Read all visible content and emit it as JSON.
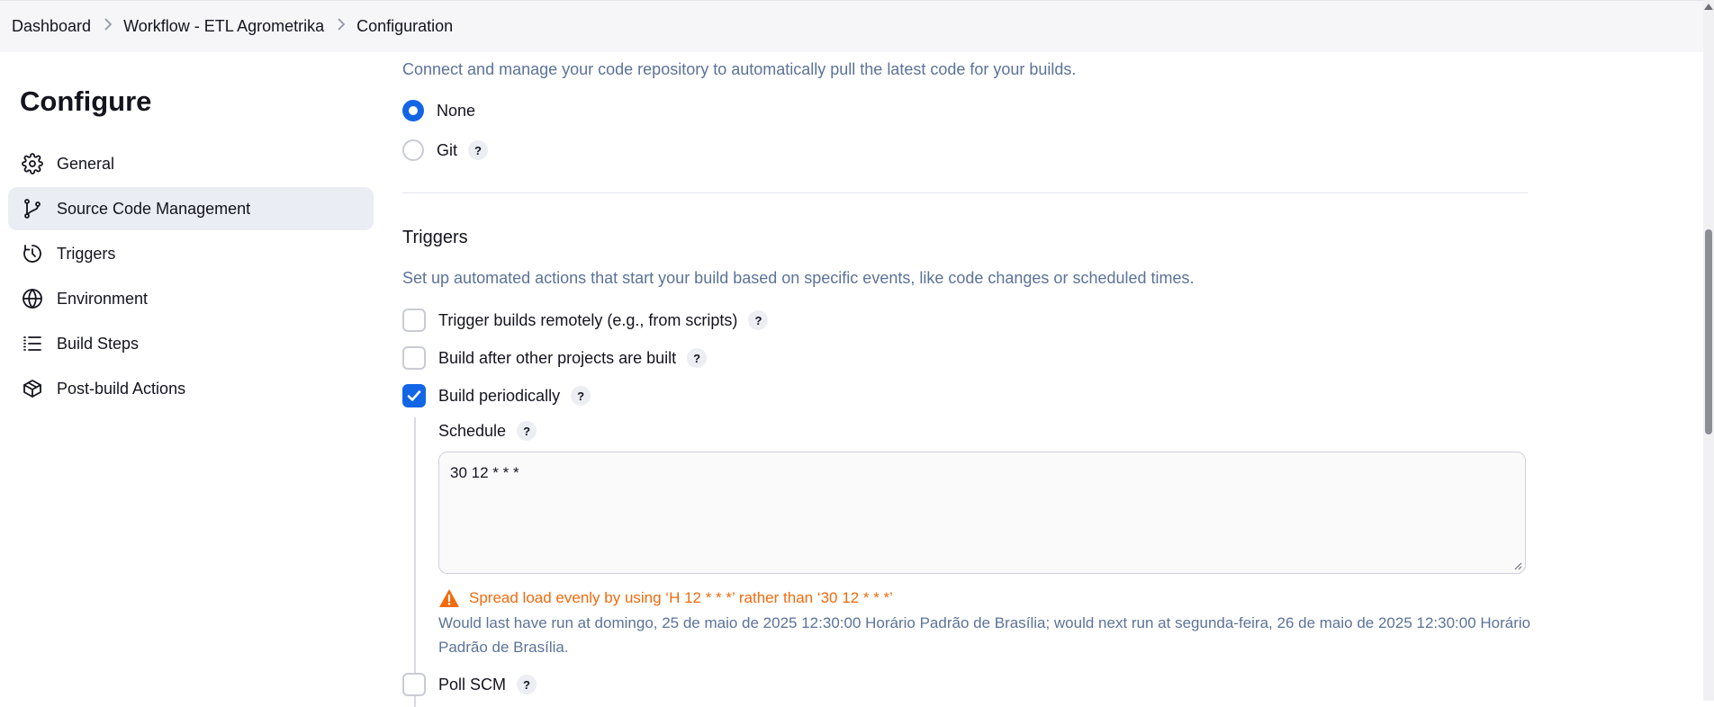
{
  "breadcrumb": {
    "items": [
      "Dashboard",
      "Workflow - ETL Agrometrika",
      "Configuration"
    ],
    "separator_icon": "chevron-right-icon"
  },
  "sidebar": {
    "title": "Configure",
    "items": [
      {
        "label": "General",
        "icon": "gear-icon",
        "active": false
      },
      {
        "label": "Source Code Management",
        "icon": "git-branch-icon",
        "active": true
      },
      {
        "label": "Triggers",
        "icon": "clock-icon",
        "active": false
      },
      {
        "label": "Environment",
        "icon": "globe-icon",
        "active": false
      },
      {
        "label": "Build Steps",
        "icon": "list-icon",
        "active": false
      },
      {
        "label": "Post-build Actions",
        "icon": "package-icon",
        "active": false
      }
    ]
  },
  "scm": {
    "description": "Connect and manage your code repository to automatically pull the latest code for your builds.",
    "options": [
      {
        "label": "None",
        "selected": true
      },
      {
        "label": "Git",
        "selected": false
      }
    ]
  },
  "triggers": {
    "title": "Triggers",
    "description": "Set up automated actions that start your build based on specific events, like code changes or scheduled times.",
    "options": [
      {
        "label": "Trigger builds remotely (e.g., from scripts)",
        "checked": false
      },
      {
        "label": "Build after other projects are built",
        "checked": false
      },
      {
        "label": "Build periodically",
        "checked": true
      },
      {
        "label": "Poll SCM",
        "checked": false
      }
    ],
    "schedule": {
      "label": "Schedule",
      "value": "30 12 * * *",
      "warning": "Spread load evenly by using ‘H 12 * * *’ rather than ‘30 12 * * *’",
      "info": "Would last have run at domingo, 25 de maio de 2025 12:30:00 Horário Padrão de Brasília; would next run at segunda-feira, 26 de maio de 2025 12:30:00 Horário Padrão de Brasília."
    }
  },
  "help_label": "?",
  "colors": {
    "accent": "#1266e6",
    "description_text": "#5b7399",
    "warning": "#f26a0d",
    "active_nav": "#eaedf3"
  }
}
